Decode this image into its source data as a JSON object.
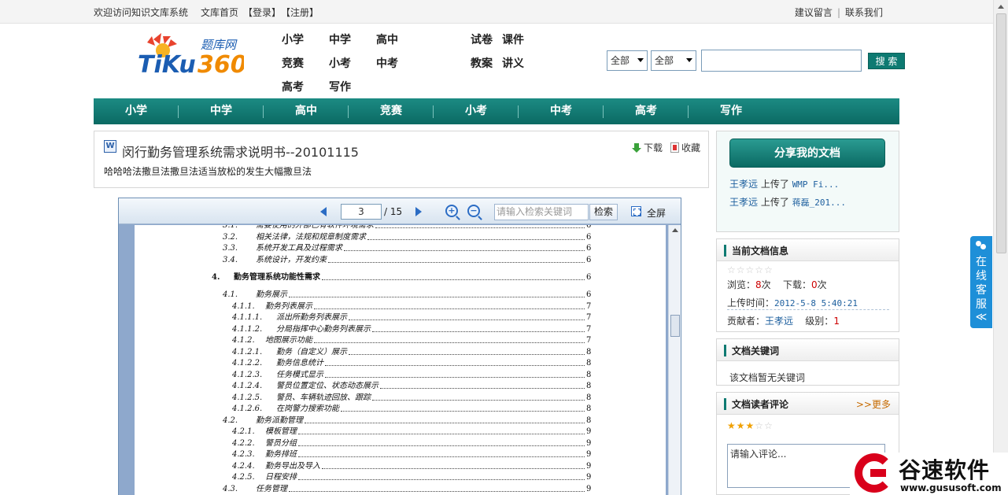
{
  "topbar": {
    "welcome": "欢迎访问知识文库系统",
    "home": "文库首页",
    "login": "【登录】",
    "register": "【注册】",
    "feedback": "建议留言",
    "sep": "|",
    "contact": "联系我们"
  },
  "logo": {
    "top_text": "题库网",
    "main_text": "TiKu360"
  },
  "subnav": [
    {
      "label": "小学"
    },
    {
      "label": "中学"
    },
    {
      "label": "高中"
    },
    {
      "label": "试卷"
    },
    {
      "label": "课件"
    },
    {
      "label": "竞赛"
    },
    {
      "label": "小考"
    },
    {
      "label": "中考"
    },
    {
      "label": "教案"
    },
    {
      "label": "讲义"
    },
    {
      "label": "高考"
    },
    {
      "label": "写作"
    }
  ],
  "search": {
    "select1": "全部",
    "select2": "全部",
    "query": "",
    "button": "搜 索"
  },
  "mainnav": [
    {
      "label": "小学"
    },
    {
      "label": "中学"
    },
    {
      "label": "高中"
    },
    {
      "label": "竞赛"
    },
    {
      "label": "小考"
    },
    {
      "label": "中考"
    },
    {
      "label": "高考"
    },
    {
      "label": "写作"
    }
  ],
  "doc": {
    "icon": "W",
    "title": "闵行勤务管理系统需求说明书--20101115",
    "description": "哈哈哈法撒旦法撒旦法适当放松的发生大幅撒旦法",
    "download": "下载",
    "favorite": "收藏"
  },
  "viewer": {
    "page": "3",
    "total": "/ 15",
    "keyword_placeholder": "请输入检索关键词",
    "search_button": "检索",
    "fullscreen": "全屏",
    "toc": [
      {
        "num": "3.1.",
        "title": "需要使用的外部已有软件环境需求",
        "page": "6"
      },
      {
        "num": "3.2.",
        "title": "相关法律，法规和规章制度需求",
        "page": "6"
      },
      {
        "num": "3.3.",
        "title": "系统开发工具及过程需求",
        "page": "6"
      },
      {
        "num": "3.4.",
        "title": "系统设计，开发约束",
        "page": "6"
      },
      {
        "num": "4.",
        "title": "勤务管理系统功能性需求",
        "page": "6"
      },
      {
        "num": "4.1.",
        "title": "勤务展示",
        "page": "6"
      },
      {
        "num": "4.1.1.",
        "title": "勤务列表展示",
        "page": "7"
      },
      {
        "num": "4.1.1.1.",
        "title": "派出所勤务列表展示",
        "page": "7"
      },
      {
        "num": "4.1.1.2.",
        "title": "分局指挥中心勤务列表展示",
        "page": "7"
      },
      {
        "num": "4.1.2.",
        "title": "地图展示功能",
        "page": "7"
      },
      {
        "num": "4.1.2.1.",
        "title": "勤务（自定义）展示",
        "page": "8"
      },
      {
        "num": "4.1.2.2.",
        "title": "勤务信息统计",
        "page": "8"
      },
      {
        "num": "4.1.2.3.",
        "title": "任务模式显示",
        "page": "8"
      },
      {
        "num": "4.1.2.4.",
        "title": "警员位置定位、状态动态展示",
        "page": "8"
      },
      {
        "num": "4.1.2.5.",
        "title": "警员、车辆轨迹回放、跟踪",
        "page": "8"
      },
      {
        "num": "4.1.2.6.",
        "title": "在岗警力搜索功能",
        "page": "8"
      },
      {
        "num": "4.2.",
        "title": "勤务派勤管理",
        "page": "8"
      },
      {
        "num": "4.2.1.",
        "title": "模板管理",
        "page": "9"
      },
      {
        "num": "4.2.2.",
        "title": "警员分组",
        "page": "9"
      },
      {
        "num": "4.2.3.",
        "title": "勤务排班",
        "page": "9"
      },
      {
        "num": "4.2.4.",
        "title": "勤务导出及导入",
        "page": "9"
      },
      {
        "num": "4.2.5.",
        "title": "日程安排",
        "page": "9"
      },
      {
        "num": "4.3.",
        "title": "任务管理",
        "page": "9"
      }
    ]
  },
  "share": {
    "button": "分享我的文档",
    "uploads": [
      {
        "user": "王孝远",
        "verb": "上传了",
        "file": "WMP Fi..."
      },
      {
        "user": "王孝远",
        "verb": "上传了",
        "file": "蒋磊_201..."
      }
    ]
  },
  "info": {
    "title": "当前文档信息",
    "views_label": "浏览：",
    "views": "8",
    "views_unit": "次",
    "downloads_label": "下载：",
    "downloads": "0",
    "downloads_unit": "次",
    "upload_time_label": "上传时间：",
    "upload_time": "2012-5-8 5:40:21",
    "contributor_label": "贡献者：",
    "contributor": "王孝远",
    "level_label": "级别：",
    "level": "1",
    "rating": 0
  },
  "keywords": {
    "title": "文档关键词",
    "empty": "该文档暂无关键词"
  },
  "comments": {
    "title": "文档读者评论",
    "more": ">>更多",
    "rating": 3,
    "placeholder": "请输入评论..."
  },
  "kefu": {
    "label": "在线客服",
    "chevron": "≪"
  },
  "watermark": {
    "name": "谷速软件",
    "url": "www.gususoft.com"
  },
  "colors": {
    "nav": "#0e7a72",
    "link": "#1d5f9e",
    "accent_red": "#cc0000"
  }
}
